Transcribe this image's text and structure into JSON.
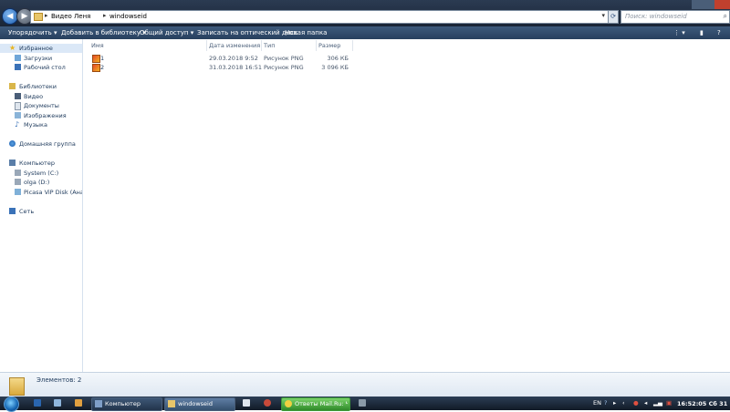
{
  "address": {
    "crumbs": [
      "Видео Леня",
      "windowseid"
    ],
    "search_placeholder": "Поиск: windowseid"
  },
  "toolbar": {
    "organize": "Упорядочить ▾",
    "add_library": "Добавить в библиотеку ▾",
    "share": "Общий доступ ▾",
    "burn": "Записать на оптический диск",
    "new_folder": "Новая папка"
  },
  "nav": {
    "favorites": "Избранное",
    "downloads": "Загрузки",
    "desktop": "Рабочий стол",
    "libraries": "Библиотеки",
    "video": "Видео",
    "documents": "Документы",
    "images": "Изображения",
    "music": "Музыка",
    "homegroup": "Домашняя группа",
    "computer": "Компьютер",
    "drive_c": "System (C:)",
    "drive_d": "olga (D:)",
    "picasa": "Picasa ViP Disk (Анапа >",
    "network": "Сеть"
  },
  "columns": {
    "name": "Имя",
    "date": "Дата изменения",
    "type": "Тип",
    "size": "Размер"
  },
  "files": [
    {
      "name": "1",
      "date": "29.03.2018 9:52",
      "type": "Рисунок PNG",
      "size": "306 КБ"
    },
    {
      "name": "2",
      "date": "31.03.2018 16:51",
      "type": "Рисунок PNG",
      "size": "3 096 КБ"
    }
  ],
  "details": {
    "count": "Элементов: 2"
  },
  "taskbar": {
    "computer": "Компьютер",
    "windowseid": "windowseid",
    "mail": "Ответы Mail.Ru: Что...",
    "lang": "EN",
    "clock": "16:52:05 Сб 31"
  },
  "colors": {
    "accent": "#1d5fb0",
    "toolbar": "#2f4a6a",
    "selection": "#dbe8f7"
  }
}
